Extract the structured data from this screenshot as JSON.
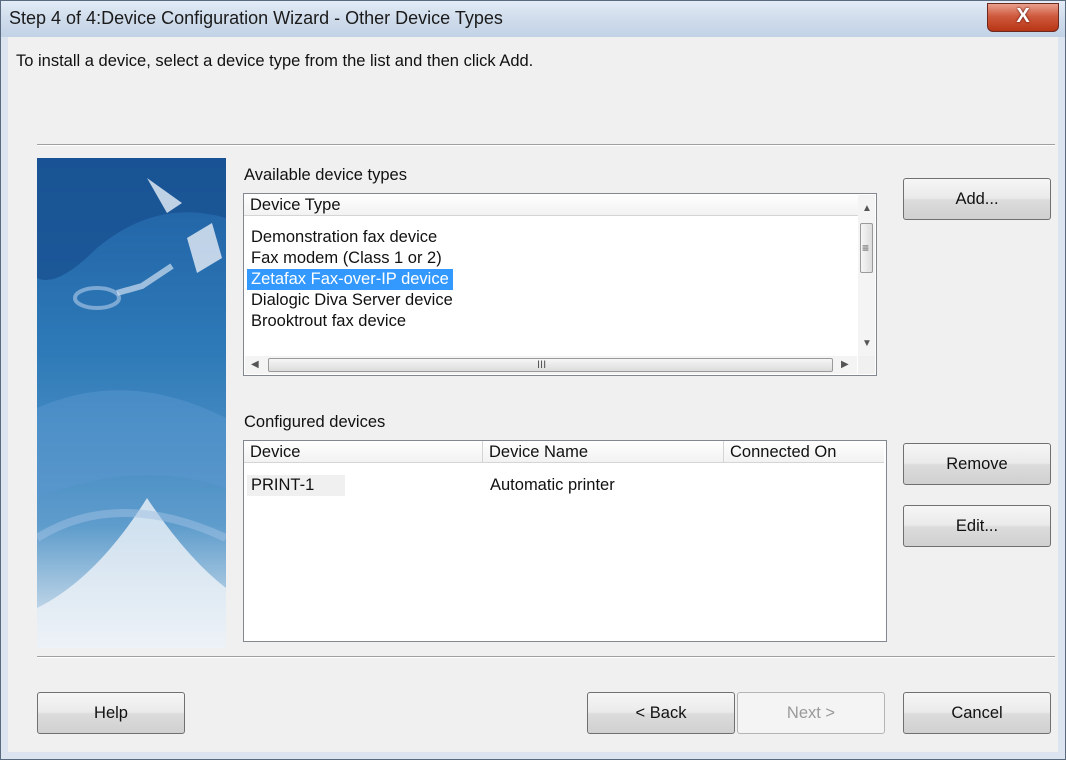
{
  "window": {
    "title": "Step 4 of 4:Device Configuration Wizard - Other Device Types",
    "close_label": "X"
  },
  "instruction": "To install a device, select a device type from the list and then click Add.",
  "available": {
    "label": "Available device types",
    "column_header": "Device Type",
    "items": [
      "Demonstration fax device",
      "Fax modem (Class 1 or 2)",
      "Zetafax Fax-over-IP device",
      "Dialogic Diva Server device",
      "Brooktrout fax device"
    ],
    "selected_index": 2,
    "hscroll_grip": "III"
  },
  "configured": {
    "label": "Configured devices",
    "columns": [
      "Device",
      "Device Name",
      "Connected On"
    ],
    "rows": [
      {
        "device": "PRINT-1",
        "device_name": "Automatic printer",
        "connected_on": ""
      }
    ]
  },
  "buttons": {
    "add": "Add...",
    "remove": "Remove",
    "edit": "Edit...",
    "help": "Help",
    "back": "< Back",
    "next": "Next >",
    "cancel": "Cancel"
  },
  "colors": {
    "selection": "#3399ff",
    "window_bg": "#f0f0f0",
    "close_button": "#c8472a"
  }
}
